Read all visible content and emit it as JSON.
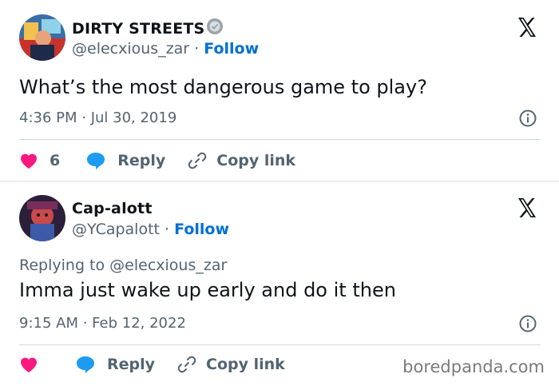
{
  "tweets": [
    {
      "display_name": "DIRTY STREETS",
      "handle": "@elecxious_zar",
      "follow_label": "Follow",
      "text": "What’s the most dangerous game to play?",
      "timestamp": "4:36 PM · Jul 30, 2019",
      "likes": "6",
      "reply_label": "Reply",
      "copy_link_label": "Copy link"
    },
    {
      "display_name": "Cap-alott",
      "handle": "@YCapalott",
      "follow_label": "Follow",
      "replying_to": "Replying to @elecxious_zar",
      "text": "Imma just wake up early and do it then",
      "timestamp": "9:15 AM · Feb 12, 2022",
      "reply_label": "Reply",
      "copy_link_label": "Copy link"
    }
  ],
  "separator": " · ",
  "watermark": "boredpanda.com",
  "colors": {
    "heart": "#f91880",
    "reply_bubble": "#1d9bf0",
    "follow": "#006fd6",
    "secondary_text": "#536471"
  },
  "icons": [
    "verified-badge-icon",
    "x-logo-icon",
    "info-icon",
    "heart-icon",
    "reply-bubble-icon",
    "link-icon"
  ]
}
